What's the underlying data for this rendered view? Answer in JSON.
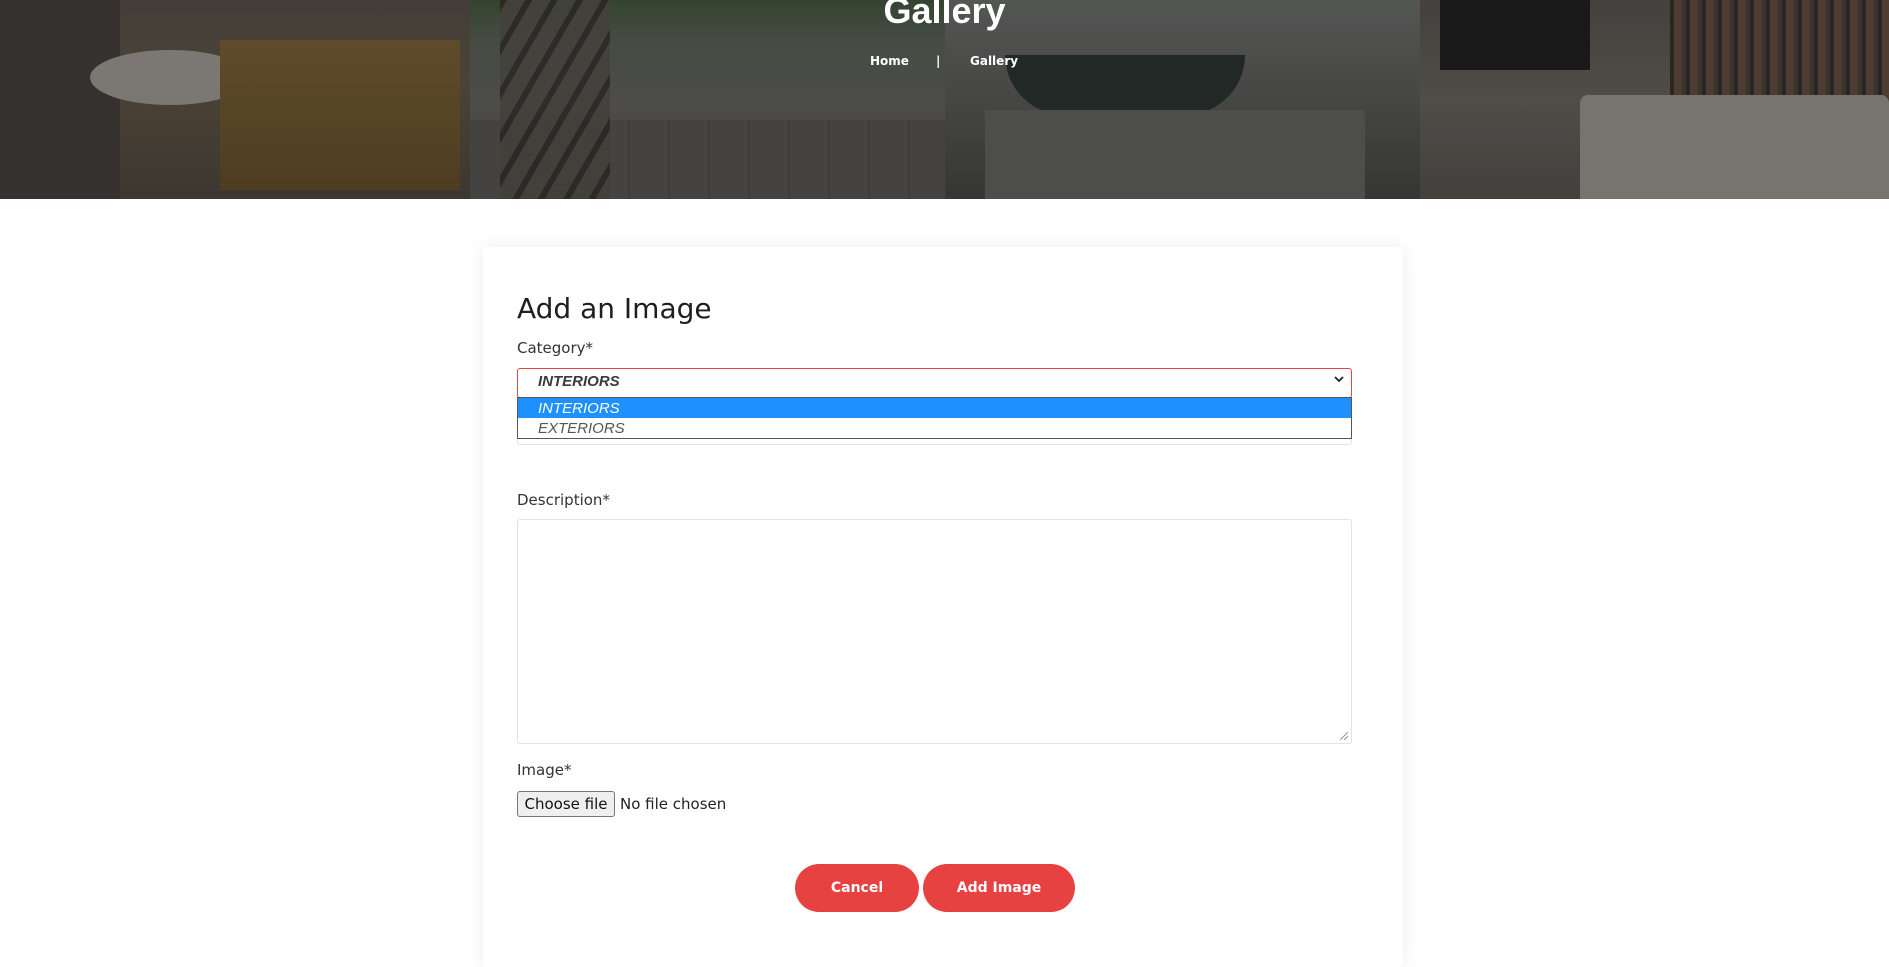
{
  "hero": {
    "title": "Gallery",
    "breadcrumb": {
      "home": "Home",
      "separator": "|",
      "current": "Gallery"
    }
  },
  "form": {
    "title": "Add an Image",
    "category": {
      "label": "Category*",
      "selected": "INTERIORS",
      "options": [
        "INTERIORS",
        "EXTERIORS"
      ],
      "highlighted_option": "INTERIORS"
    },
    "description": {
      "label": "Description*",
      "value": ""
    },
    "image": {
      "label": "Image*",
      "button_label": "Choose file",
      "status": "No file chosen"
    },
    "buttons": {
      "cancel": "Cancel",
      "submit": "Add Image"
    }
  },
  "colors": {
    "accent": "#e84142",
    "select_border": "#e24545",
    "option_highlight": "#1e90ff"
  },
  "icons": {
    "select_chevron": "chevron-down-icon",
    "textarea_resize": "resize-handle-icon"
  }
}
